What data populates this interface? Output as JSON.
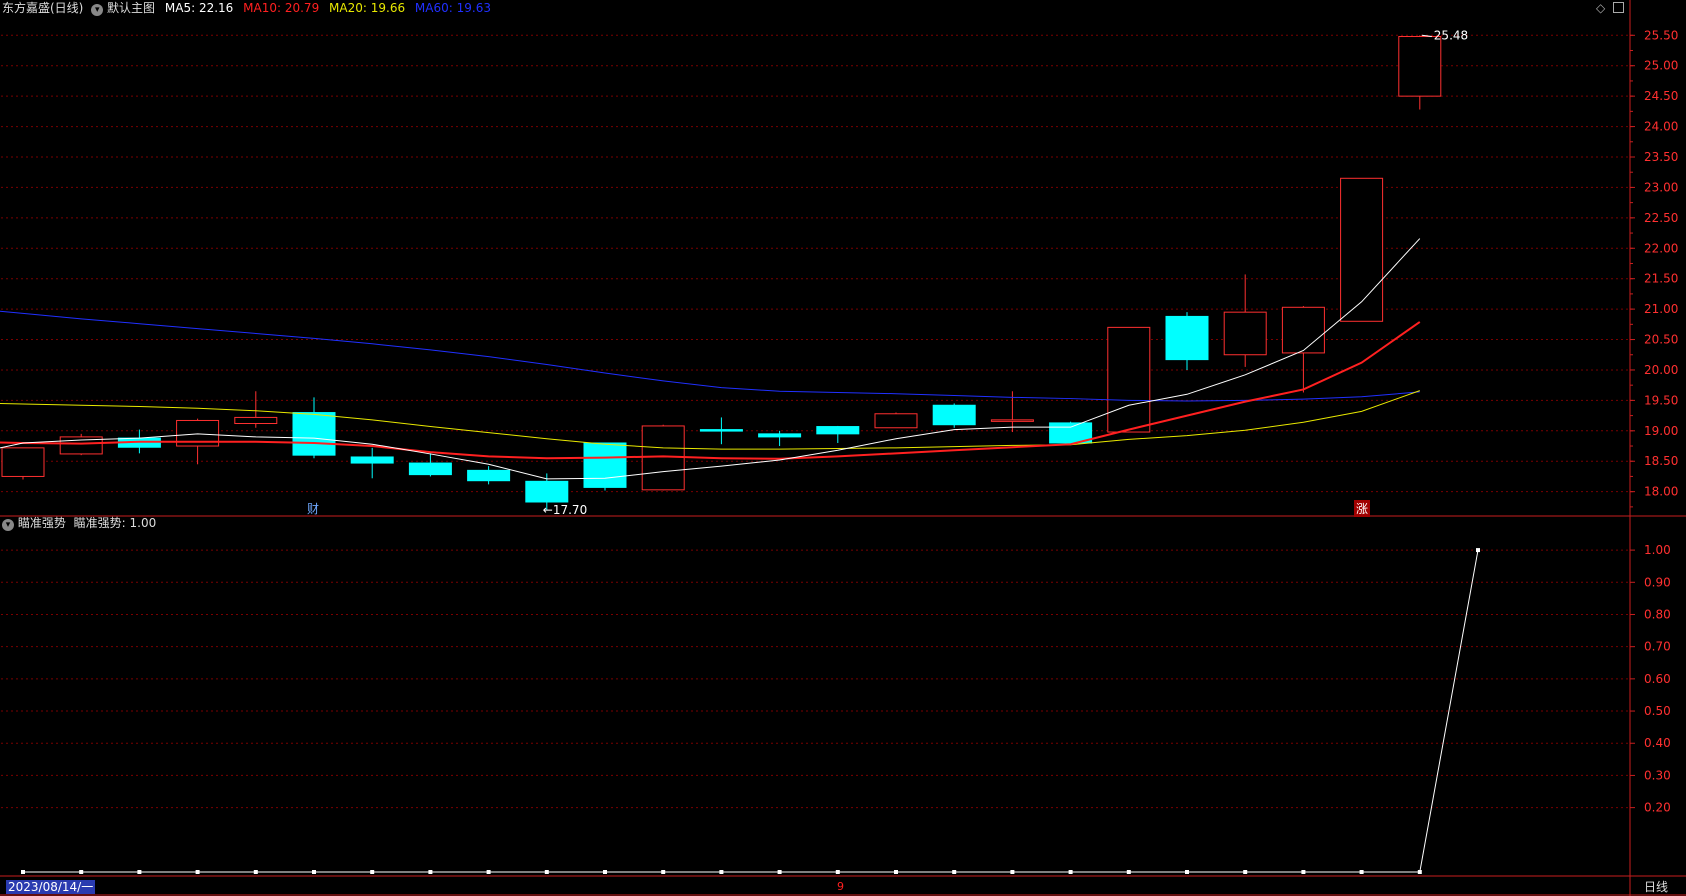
{
  "header": {
    "stock_name": "东方嘉盛(日线)",
    "main_chart_label": "默认主图",
    "ma5": {
      "label": "MA5:",
      "value": "22.16",
      "color": "#ffffff"
    },
    "ma10": {
      "label": "MA10:",
      "value": "20.79",
      "color": "#ff2020"
    },
    "ma20": {
      "label": "MA20:",
      "value": "19.66",
      "color": "#ffff00"
    },
    "ma60": {
      "label": "MA60:",
      "value": "19.63",
      "color": "#2030ff"
    }
  },
  "sub_header": {
    "indicator_name": "瞄准强势",
    "line_label": "瞄准强势:",
    "line_value": "1.00"
  },
  "markers": {
    "fin_tag": "财",
    "zhang_tag": "涨",
    "low_label": "17.70",
    "high_label": "25.48"
  },
  "bottom_bar": {
    "date": "2023/08/14/一",
    "month_mark": "9",
    "period": "日线"
  },
  "colors": {
    "up": "#ff3030",
    "down": "#00ffff",
    "grid": "#7a0000",
    "axis": "#c81e1e",
    "ma5": "#ffffff",
    "ma10": "#ff2020",
    "ma20": "#e8e800",
    "ma60": "#2030ff",
    "indicator": "#ffffff"
  },
  "chart_data": {
    "type": "candlestick",
    "main": {
      "ylim": [
        17.6,
        25.85
      ],
      "ticks": [
        "18.00",
        "18.50",
        "19.00",
        "19.50",
        "20.00",
        "20.50",
        "21.00",
        "21.50",
        "22.00",
        "22.50",
        "23.00",
        "23.50",
        "24.00",
        "24.50",
        "25.00",
        "25.50"
      ],
      "candles": [
        {
          "o": 18.25,
          "h": 18.25,
          "l": 18.2,
          "c": 18.72
        },
        {
          "o": 18.62,
          "h": 18.95,
          "l": 18.6,
          "c": 18.9
        },
        {
          "o": 18.88,
          "h": 19.02,
          "l": 18.63,
          "c": 18.73
        },
        {
          "o": 18.75,
          "h": 19.2,
          "l": 18.45,
          "c": 19.17
        },
        {
          "o": 19.12,
          "h": 19.65,
          "l": 19.05,
          "c": 19.22
        },
        {
          "o": 19.3,
          "h": 19.55,
          "l": 18.55,
          "c": 18.6
        },
        {
          "o": 18.57,
          "h": 18.72,
          "l": 18.22,
          "c": 18.47
        },
        {
          "o": 18.47,
          "h": 18.63,
          "l": 18.25,
          "c": 18.28
        },
        {
          "o": 18.35,
          "h": 18.42,
          "l": 18.12,
          "c": 18.18
        },
        {
          "o": 18.17,
          "h": 18.3,
          "l": 17.7,
          "c": 17.83
        },
        {
          "o": 18.8,
          "h": 18.8,
          "l": 18.02,
          "c": 18.07
        },
        {
          "o": 18.03,
          "h": 19.1,
          "l": 18.02,
          "c": 19.08
        },
        {
          "o": 19.02,
          "h": 19.22,
          "l": 18.78,
          "c": 19.0
        },
        {
          "o": 18.95,
          "h": 19.0,
          "l": 18.75,
          "c": 18.9
        },
        {
          "o": 19.07,
          "h": 19.08,
          "l": 18.8,
          "c": 18.95
        },
        {
          "o": 19.05,
          "h": 19.3,
          "l": 19.05,
          "c": 19.28
        },
        {
          "o": 19.42,
          "h": 19.45,
          "l": 19.05,
          "c": 19.1
        },
        {
          "o": 19.17,
          "h": 19.65,
          "l": 18.98,
          "c": 19.18
        },
        {
          "o": 19.13,
          "h": 19.15,
          "l": 18.78,
          "c": 18.8
        },
        {
          "o": 18.98,
          "h": 20.7,
          "l": 18.98,
          "c": 20.7
        },
        {
          "o": 20.88,
          "h": 20.95,
          "l": 20.0,
          "c": 20.17
        },
        {
          "o": 20.25,
          "h": 21.57,
          "l": 20.05,
          "c": 20.95
        },
        {
          "o": 20.28,
          "h": 21.05,
          "l": 19.63,
          "c": 21.03
        },
        {
          "o": 20.8,
          "h": 23.15,
          "l": 20.8,
          "c": 23.15
        },
        {
          "o": 24.5,
          "h": 25.5,
          "l": 24.28,
          "c": 25.48
        }
      ],
      "ma5": [
        18.72,
        18.8,
        18.85,
        18.88,
        18.95,
        18.9,
        18.88,
        18.78,
        18.62,
        18.45,
        18.21,
        18.22,
        18.33,
        18.42,
        18.52,
        18.68,
        18.87,
        19.02,
        19.06,
        19.06,
        19.42,
        19.6,
        19.92,
        20.32,
        21.12,
        22.16
      ],
      "ma10": [
        18.88,
        18.82,
        18.8,
        18.79,
        18.82,
        18.82,
        18.82,
        18.8,
        18.75,
        18.65,
        18.58,
        18.55,
        18.56,
        18.58,
        18.55,
        18.54,
        18.58,
        18.63,
        18.68,
        18.73,
        18.78,
        19.02,
        19.25,
        19.48,
        19.68,
        20.12,
        20.79
      ],
      "ma20": [
        19.48,
        19.46,
        19.44,
        19.42,
        19.4,
        19.37,
        19.33,
        19.27,
        19.18,
        19.07,
        18.97,
        18.87,
        18.78,
        18.72,
        18.7,
        18.7,
        18.71,
        18.72,
        18.74,
        18.76,
        18.77,
        18.86,
        18.92,
        19.01,
        19.14,
        19.32,
        19.66
      ],
      "ma60": [
        21.12,
        21.02,
        20.93,
        20.84,
        20.76,
        20.68,
        20.6,
        20.52,
        20.43,
        20.33,
        20.22,
        20.09,
        19.95,
        19.82,
        19.71,
        19.65,
        19.63,
        19.61,
        19.58,
        19.55,
        19.53,
        19.5,
        19.49,
        19.5,
        19.52,
        19.56,
        19.64
      ]
    },
    "indicator": {
      "name": "瞄准强势",
      "ylim": [
        0,
        1.05
      ],
      "ticks": [
        "0.20",
        "0.30",
        "0.40",
        "0.50",
        "0.60",
        "0.70",
        "0.80",
        "0.90",
        "1.00"
      ],
      "values": [
        0,
        0,
        0,
        0,
        0,
        0,
        0,
        0,
        0,
        0,
        0,
        0,
        0,
        0,
        0,
        0,
        0,
        0,
        0,
        0,
        0,
        0,
        0,
        0,
        0,
        1.0
      ]
    }
  }
}
